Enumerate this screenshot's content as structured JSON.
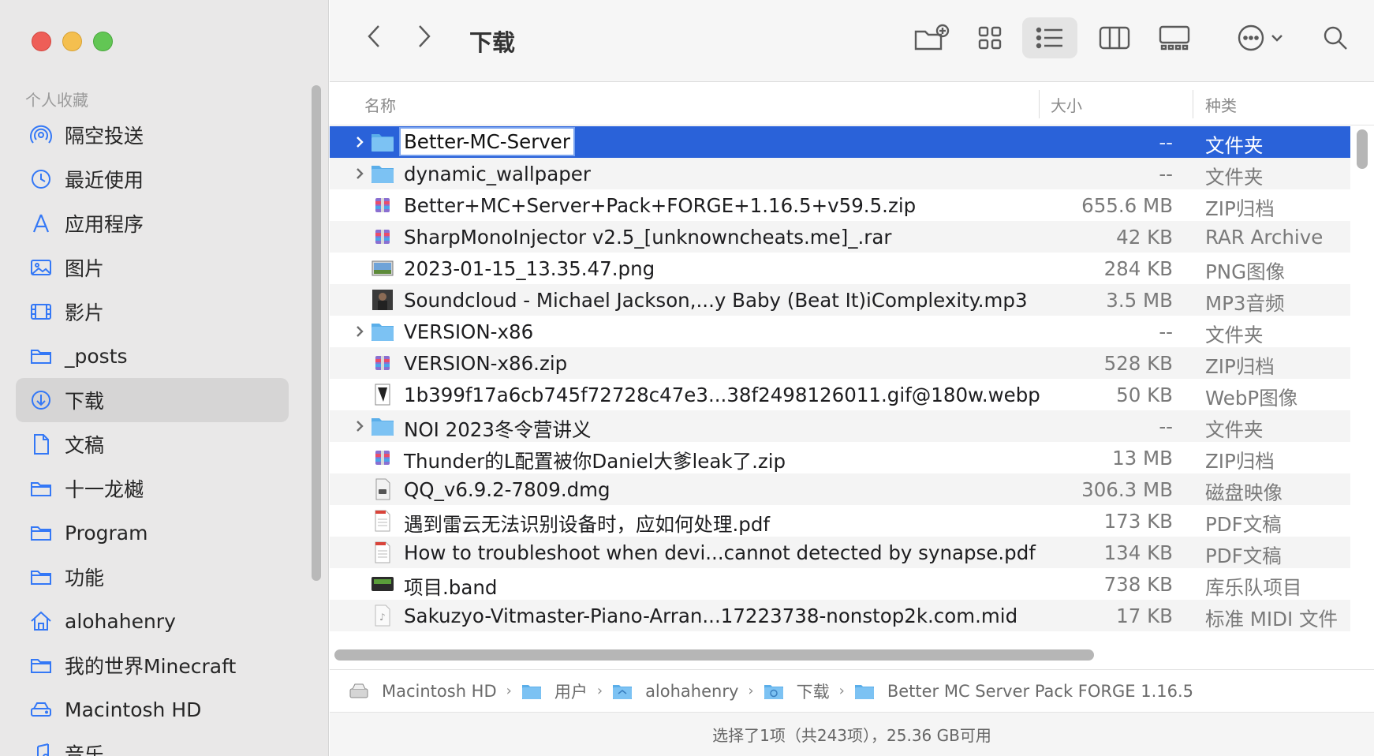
{
  "window": {
    "title": "下载"
  },
  "sidebar": {
    "section_title": "个人收藏",
    "items": [
      {
        "label": "隔空投送",
        "icon": "airdrop-icon"
      },
      {
        "label": "最近使用",
        "icon": "clock-icon"
      },
      {
        "label": "应用程序",
        "icon": "applications-icon"
      },
      {
        "label": "图片",
        "icon": "photo-icon"
      },
      {
        "label": "影片",
        "icon": "film-icon"
      },
      {
        "label": "_posts",
        "icon": "folder-icon"
      },
      {
        "label": "下载",
        "icon": "download-icon",
        "active": true
      },
      {
        "label": "文稿",
        "icon": "document-icon"
      },
      {
        "label": "十一龙樾",
        "icon": "folder-icon"
      },
      {
        "label": "Program",
        "icon": "folder-icon"
      },
      {
        "label": "功能",
        "icon": "folder-icon"
      },
      {
        "label": "alohahenry",
        "icon": "home-icon"
      },
      {
        "label": "我的世界Minecraft",
        "icon": "folder-icon"
      },
      {
        "label": "Macintosh HD",
        "icon": "drive-icon"
      },
      {
        "label": "音乐",
        "icon": "music-icon"
      }
    ]
  },
  "columns": {
    "name": "名称",
    "size": "大小",
    "kind": "种类"
  },
  "files": [
    {
      "name": "Better-MC-Server",
      "size": "--",
      "kind": "文件夹",
      "type": "folder",
      "expandable": true,
      "selected": true
    },
    {
      "name": "dynamic_wallpaper",
      "size": "--",
      "kind": "文件夹",
      "type": "folder",
      "expandable": true
    },
    {
      "name": "Better+MC+Server+Pack+FORGE+1.16.5+v59.5.zip",
      "size": "655.6 MB",
      "kind": "ZIP归档",
      "type": "archive"
    },
    {
      "name": "SharpMonoInjector v2.5_[unknowncheats.me]_.rar",
      "size": "42 KB",
      "kind": "RAR Archive",
      "type": "archive"
    },
    {
      "name": "2023-01-15_13.35.47.png",
      "size": "284 KB",
      "kind": "PNG图像",
      "type": "image"
    },
    {
      "name": "Soundcloud - Michael Jackson,...y Baby (Beat It)iComplexity.mp3",
      "size": "3.5 MB",
      "kind": "MP3音频",
      "type": "audio"
    },
    {
      "name": "VERSION-x86",
      "size": "--",
      "kind": "文件夹",
      "type": "folder",
      "expandable": true
    },
    {
      "name": "VERSION-x86.zip",
      "size": "528 KB",
      "kind": "ZIP归档",
      "type": "archive"
    },
    {
      "name": "1b399f17a6cb745f72728c47e3...38f2498126011.gif@180w.webp",
      "size": "50 KB",
      "kind": "WebP图像",
      "type": "webp"
    },
    {
      "name": "NOI 2023冬令营讲义",
      "size": "--",
      "kind": "文件夹",
      "type": "folder",
      "expandable": true
    },
    {
      "name": "Thunder的L配置被你Daniel大爹leak了.zip",
      "size": "13 MB",
      "kind": "ZIP归档",
      "type": "archive"
    },
    {
      "name": "QQ_v6.9.2-7809.dmg",
      "size": "306.3 MB",
      "kind": "磁盘映像",
      "type": "disk"
    },
    {
      "name": "遇到雷云无法识别设备时，应如何处理.pdf",
      "size": "173 KB",
      "kind": "PDF文稿",
      "type": "pdf"
    },
    {
      "name": "How to troubleshoot when devi...cannot detected by synapse.pdf",
      "size": "134 KB",
      "kind": "PDF文稿",
      "type": "pdf"
    },
    {
      "name": "项目.band",
      "size": "738 KB",
      "kind": "库乐队项目",
      "type": "band"
    },
    {
      "name": "Sakuzyo-Vitmaster-Piano-Arran...17223738-nonstop2k.com.mid",
      "size": "17 KB",
      "kind": "标准 MIDI 文件",
      "type": "midi"
    }
  ],
  "pathbar": [
    {
      "label": "Macintosh HD",
      "icon": "drive-icon"
    },
    {
      "label": "用户",
      "icon": "folder-icon"
    },
    {
      "label": "alohahenry",
      "icon": "home-folder-icon"
    },
    {
      "label": "下载",
      "icon": "download-folder-icon"
    },
    {
      "label": "Better MC Server Pack FORGE 1.16.5",
      "icon": "folder-icon"
    }
  ],
  "status": "选择了1项（共243项），25.36 GB可用",
  "colors": {
    "selection": "#2a62d9",
    "folder": "#6cb8f0",
    "sidebar_bg": "#e9e8e8"
  }
}
